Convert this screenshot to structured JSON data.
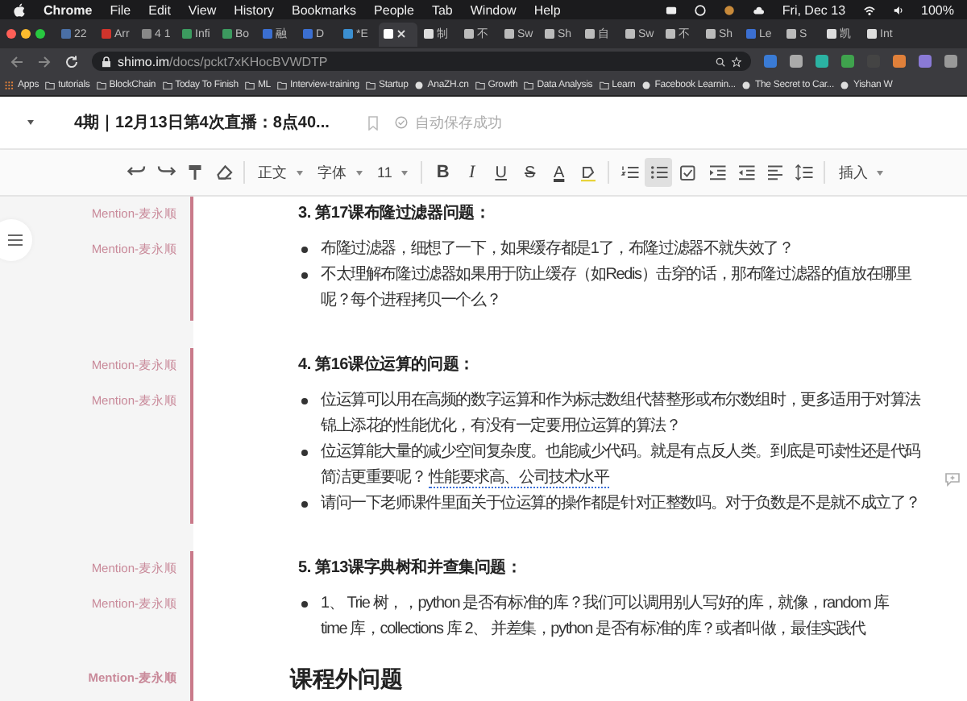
{
  "menu_bar": {
    "app": "Chrome",
    "items": [
      "File",
      "Edit",
      "View",
      "History",
      "Bookmarks",
      "People",
      "Tab",
      "Window",
      "Help"
    ],
    "clock": "Fri, Dec 13",
    "battery": "100%"
  },
  "tabs": [
    {
      "label": "22",
      "selected": false,
      "color": "#4a6fa5"
    },
    {
      "label": "Arr",
      "selected": false,
      "color": "#d0342c"
    },
    {
      "label": "4 1",
      "selected": false,
      "color": "#888888"
    },
    {
      "label": "Infi",
      "selected": false,
      "color": "#3c9a5f"
    },
    {
      "label": "Bo",
      "selected": false,
      "color": "#3c9a5f"
    },
    {
      "label": "融",
      "selected": false,
      "color": "#3b6fd1"
    },
    {
      "label": "D",
      "selected": false,
      "color": "#3b6fd1"
    },
    {
      "label": "*E",
      "selected": false,
      "color": "#3b8fd1"
    },
    {
      "selected": true,
      "color": "#ffffff"
    },
    {
      "label": "制",
      "selected": false,
      "color": "#dddddd"
    },
    {
      "label": "不",
      "selected": false,
      "color": "#bbbbbb"
    },
    {
      "label": "Sw",
      "selected": false,
      "color": "#bbbbbb"
    },
    {
      "label": "Sh",
      "selected": false,
      "color": "#bbbbbb"
    },
    {
      "label": "自",
      "selected": false,
      "color": "#bbbbbb"
    },
    {
      "label": "Sw",
      "selected": false,
      "color": "#bbbbbb"
    },
    {
      "label": "不",
      "selected": false,
      "color": "#bbbbbb"
    },
    {
      "label": "Sh",
      "selected": false,
      "color": "#bbbbbb"
    },
    {
      "label": "Le",
      "selected": false,
      "color": "#3b6fd1"
    },
    {
      "label": "S",
      "selected": false,
      "color": "#bbbbbb"
    },
    {
      "label": "凯",
      "selected": false,
      "color": "#dddddd"
    },
    {
      "label": "Int",
      "selected": false,
      "color": "#dddddd"
    }
  ],
  "address_bar": {
    "host": "shimo.im",
    "path": "/docs/pckt7xKHocBVWDTP"
  },
  "bookmarks": [
    {
      "label": "Apps",
      "kind": "apps"
    },
    {
      "label": "tutorials",
      "kind": "folder"
    },
    {
      "label": "BlockChain",
      "kind": "folder"
    },
    {
      "label": "Today To Finish",
      "kind": "folder"
    },
    {
      "label": "ML",
      "kind": "folder"
    },
    {
      "label": "Interview-training",
      "kind": "folder"
    },
    {
      "label": "Startup",
      "kind": "folder"
    },
    {
      "label": "AnaZH.cn",
      "kind": "site"
    },
    {
      "label": "Growth",
      "kind": "folder"
    },
    {
      "label": "Data Analysis",
      "kind": "folder"
    },
    {
      "label": "Learn",
      "kind": "folder"
    },
    {
      "label": "Facebook Learnin...",
      "kind": "site"
    },
    {
      "label": "The Secret to Car...",
      "kind": "site"
    },
    {
      "label": "Yishan W",
      "kind": "site"
    }
  ],
  "document": {
    "title": "4期｜12月13日第4次直播：8点40...",
    "save_status": "自动保存成功"
  },
  "toolbar": [
    {
      "kind": "undo"
    },
    {
      "kind": "redo"
    },
    {
      "kind": "format-painter"
    },
    {
      "kind": "eraser"
    },
    {
      "kind": "sep"
    },
    {
      "kind": "dropdown",
      "label": "正文"
    },
    {
      "kind": "dropdown",
      "label": "字体"
    },
    {
      "kind": "dropdown",
      "label": "11"
    },
    {
      "kind": "sep"
    },
    {
      "kind": "bold",
      "label": "B"
    },
    {
      "kind": "italic",
      "label": "I"
    },
    {
      "kind": "underline",
      "label": "U"
    },
    {
      "kind": "strike",
      "label": "S"
    },
    {
      "kind": "text-color",
      "label": "A"
    },
    {
      "kind": "highlight"
    },
    {
      "kind": "sep"
    },
    {
      "kind": "numbered-list"
    },
    {
      "kind": "bullet-list",
      "selected": true
    },
    {
      "kind": "checklist"
    },
    {
      "kind": "indent"
    },
    {
      "kind": "outdent"
    },
    {
      "kind": "align"
    },
    {
      "kind": "line-height"
    },
    {
      "kind": "sep"
    },
    {
      "kind": "dropdown",
      "label": "插入"
    }
  ],
  "sections": [
    {
      "annotated": true,
      "blocks": [
        {
          "kind": "heading",
          "mention": "Mention-麦永顺",
          "lines": [
            "3. 第17课布隆过滤器问题："
          ]
        },
        {
          "kind": "bullet",
          "mention": "Mention-麦永顺",
          "lines": [
            "布隆过滤器，细想了一下，如果缓存都是1了，布隆过滤器不就失效了？"
          ]
        },
        {
          "kind": "bullet",
          "lines": [
            "不太理解布隆过滤器如果用于防止缓存（如Redis）击穿的话，那布隆过滤器的值放在哪里",
            "呢？每个进程拷贝一个么？"
          ]
        }
      ]
    },
    {
      "annotated": true,
      "blocks": [
        {
          "kind": "heading",
          "mention": "Mention-麦永顺",
          "lines": [
            "4. 第16课位运算的问题："
          ]
        },
        {
          "kind": "bullet",
          "mention": "Mention-麦永顺",
          "lines": [
            "位运算可以用在高频的数字运算和作为标志数组代替整形或布尔数组时，更多适用于对算法",
            "锦上添花的性能优化，有没有一定要用位运算的算法？"
          ]
        },
        {
          "kind": "bullet",
          "has_comment": true,
          "lines": [
            "位运算能大量的减少空间复杂度。也能减少代码。就是有点反人类。到底是可读性还是代码",
            "简洁更重要呢？"
          ],
          "note": "性能要求高、公司技术水平"
        },
        {
          "kind": "bullet",
          "lines": [
            "请问一下老师课件里面关于位运算的操作都是针对正整数吗。对于负数是不是就不成立了？"
          ]
        }
      ]
    },
    {
      "annotated": true,
      "blocks": [
        {
          "kind": "heading",
          "mention": "Mention-麦永顺",
          "lines": [
            "5. 第13课字典树和并查集问题："
          ]
        },
        {
          "kind": "bullet",
          "mention": "Mention-麦永顺",
          "lines": [
            "1、 Trie 树，，python 是否有标准的库？我们可以调用别人写好的库，就像，random 库",
            "time 库，collections 库 2、 并差集，python 是否有标准的库？或者叫做，最佳实践代"
          ]
        },
        {
          "kind": "title",
          "mention": "Mention-麦永顺",
          "lines": [
            "课程外问题"
          ]
        }
      ]
    }
  ]
}
